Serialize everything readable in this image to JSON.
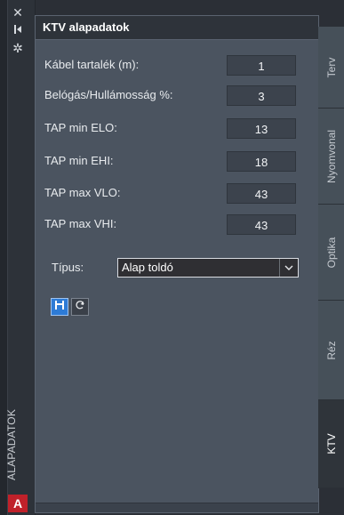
{
  "rail": {
    "label": "ALAPADATOK",
    "logo": "A",
    "icons": [
      "close-icon",
      "pin-icon",
      "settings-icon"
    ]
  },
  "panel": {
    "title": "KTV alapadatok",
    "fields": [
      {
        "label": "Kábel tartalék (m):",
        "value": "1"
      },
      {
        "label": "Belógás/Hullámosság %:",
        "value": "3"
      },
      {
        "label": "TAP min ELO:",
        "value": "13"
      },
      {
        "label": "TAP min EHI:",
        "value": "18"
      },
      {
        "label": "TAP max VLO:",
        "value": "43"
      },
      {
        "label": "TAP max VHI:",
        "value": "43"
      }
    ],
    "tipus_label": "Típus:",
    "tipus_value": "Alap toldó",
    "buttons": [
      "save-icon",
      "refresh-icon"
    ]
  },
  "tabs": [
    {
      "label": "Terv",
      "active": false
    },
    {
      "label": "Nyomvonal",
      "active": false
    },
    {
      "label": "Optika",
      "active": false
    },
    {
      "label": "Réz",
      "active": false
    },
    {
      "label": "KTV",
      "active": true
    }
  ],
  "colors": {
    "background": "#2b2f36",
    "panel": "#4b5460",
    "accent": "#2d7bd6",
    "logo": "#c0212a"
  }
}
